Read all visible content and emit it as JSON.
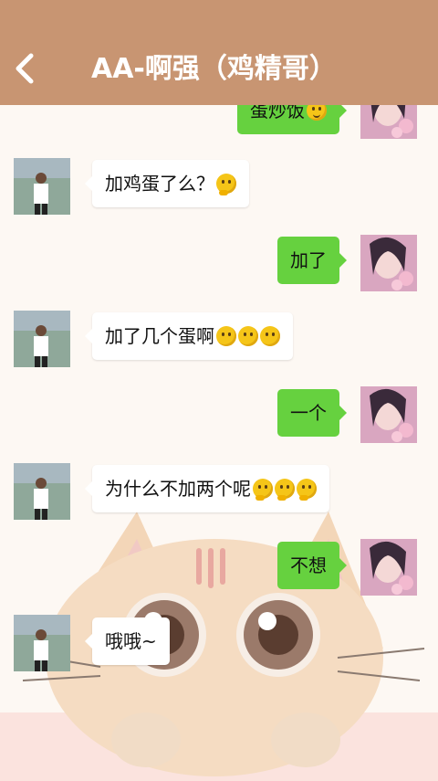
{
  "header": {
    "title": "AA-啊强（鸡精哥）",
    "back_icon": "chevron-left-icon",
    "color": "#c89572"
  },
  "colors": {
    "my_bubble": "#66d13f",
    "their_bubble": "#ffffff",
    "background": "#fdf8f3"
  },
  "messages": [
    {
      "side": "right",
      "text": "蛋炒饭",
      "emoji": [
        "grinning-face"
      ]
    },
    {
      "side": "left",
      "text": "加鸡蛋了么？",
      "emoji": [
        "thinking-face"
      ]
    },
    {
      "side": "right",
      "text": "加了",
      "emoji": []
    },
    {
      "side": "left",
      "text": "加了几个蛋啊",
      "emoji": [
        "hand-over-mouth-face",
        "hand-over-mouth-face",
        "hand-over-mouth-face"
      ]
    },
    {
      "side": "right",
      "text": "一个",
      "emoji": []
    },
    {
      "side": "left",
      "text": "为什么不加两个呢",
      "emoji": [
        "thinking-face",
        "thinking-face",
        "thinking-face"
      ]
    },
    {
      "side": "right",
      "text": "不想",
      "emoji": []
    },
    {
      "side": "left",
      "text": "哦哦~",
      "emoji": []
    }
  ]
}
